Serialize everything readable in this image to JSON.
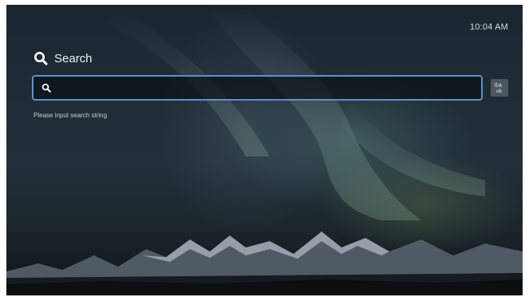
{
  "status_bar": {
    "time": "10:04 AM"
  },
  "header": {
    "title": "Search",
    "icon": "search-icon"
  },
  "search": {
    "value": "",
    "placeholder": "",
    "icon": "search-icon",
    "hint": "Please input search string"
  },
  "keyboard_button": {
    "icon": "language-keyboard-icon"
  },
  "colors": {
    "focus_border": "#5f8fcf",
    "text": "#eef1f3",
    "background": "#1f2c35"
  }
}
